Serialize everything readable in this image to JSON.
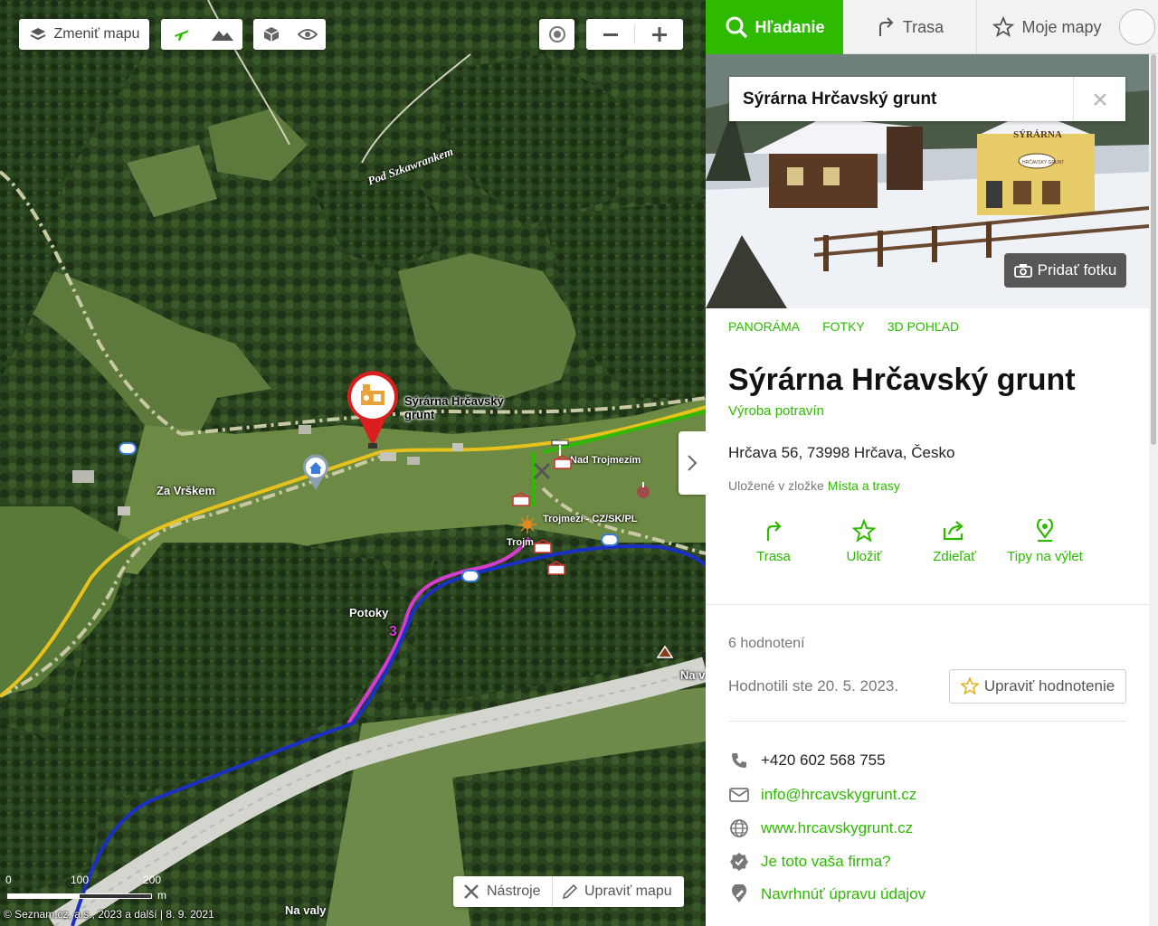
{
  "map": {
    "change_map_label": "Zmeniť mapu",
    "labels": {
      "pod_szkawrankem": "Pod Szkawrankem",
      "za_vrskem": "Za Vrškem",
      "nad_trojmezim": "Nad Trojmezím",
      "trojmezi_border": "Trojmezí - CZ/SK/PL",
      "trojm": "Trojm",
      "potoky": "Potoky",
      "na_v": "Na v",
      "na_valy": "Na valy",
      "trail_number": "3"
    },
    "poi_label": "Sýrárna Hrčavský grunt",
    "tools": {
      "tools_label": "Nástroje",
      "edit_map_label": "Upraviť mapu"
    },
    "scale": {
      "ticks": [
        "0",
        "100",
        "200"
      ],
      "unit": "m"
    },
    "attribution": "© Seznam.cz, a.s., 2023 a další | 8. 9. 2021"
  },
  "tabs": {
    "search": "Hľadanie",
    "route": "Trasa",
    "my_maps": "Moje mapy"
  },
  "search": {
    "value": "Sýrárna Hrčavský grunt"
  },
  "hero": {
    "add_photo": "Pridať fotku",
    "sign_text": "SÝRÁRNA",
    "sign_small": "HRČAVSKÝ GRUNT"
  },
  "media_links": [
    "PANORÁMA",
    "FOTKY",
    "3D POHĽAD"
  ],
  "place": {
    "title": "Sýrárna Hrčavský grunt",
    "category": "Výroba potravín",
    "address": "Hrčava 56, 73998 Hrčava, Česko",
    "saved_prefix": "Uložené v zložke",
    "saved_folder": "Místa a trasy"
  },
  "actions": [
    {
      "label": "Trasa",
      "icon": "route-icon"
    },
    {
      "label": "Uložiť",
      "icon": "star-icon"
    },
    {
      "label": "Zdieľať",
      "icon": "share-icon"
    },
    {
      "label": "Tipy na výlet",
      "icon": "trip-tips-icon"
    }
  ],
  "rating": {
    "count_text": "6 hodnotení",
    "rated_text": "Hodnotili ste 20. 5. 2023.",
    "edit_label": "Upraviť hodnotenie"
  },
  "contacts": {
    "phone": "+420 602 568 755",
    "email": "info@hrcavskygrunt.cz",
    "web": "www.hrcavskygrunt.cz",
    "claim": "Je toto vaša firma?",
    "suggest": "Navrhnúť úpravu údajov"
  },
  "colors": {
    "accent": "#2dba00",
    "trail_yellow": "#e6c21a",
    "trail_blue": "#1a2fc4",
    "trail_magenta": "#d63ccf",
    "trail_green": "#2dba00",
    "pin_red": "#d81e1e"
  }
}
